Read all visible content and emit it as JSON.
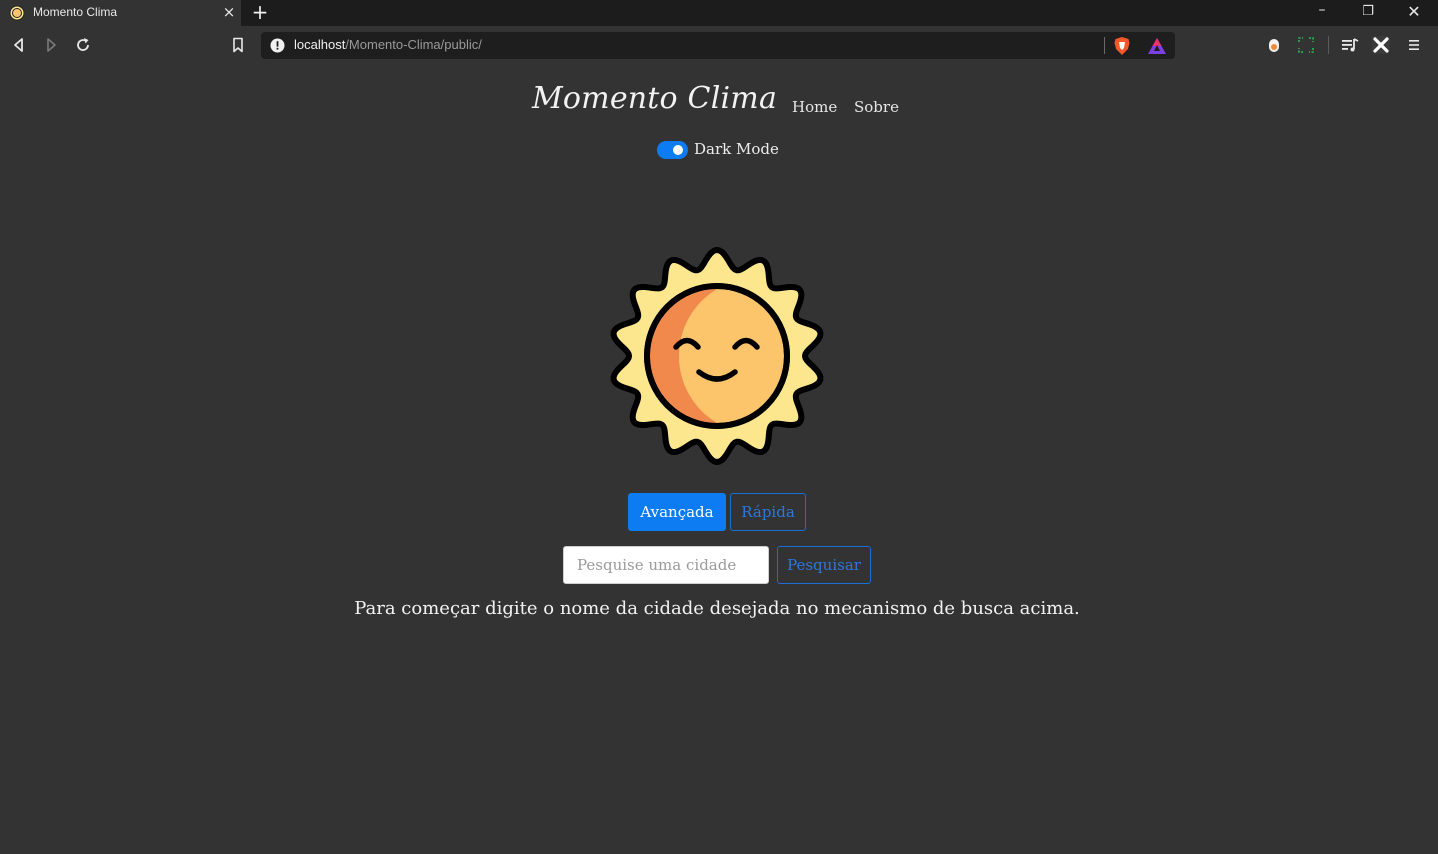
{
  "browser": {
    "tab_title": "Momento Clima",
    "tab_close": "×",
    "new_tab": "+",
    "window_controls": {
      "minimize": "–",
      "restore": "❐",
      "close": "✕"
    },
    "url_host": "localhost",
    "url_path": "/Momento-Clima/public/",
    "icons": [
      "back-icon",
      "forward-icon",
      "reload-icon",
      "bookmark-icon",
      "site-info-icon",
      "brave-shield-icon",
      "brave-rewards-icon",
      "extension-icon",
      "screen-capture-icon",
      "media-queue-icon",
      "extension-x-icon",
      "menu-icon"
    ]
  },
  "header": {
    "brand": "Momento Clima",
    "nav": [
      {
        "label": "Home"
      },
      {
        "label": "Sobre"
      }
    ],
    "dark_mode_label": "Dark Mode",
    "dark_mode_on": true
  },
  "main": {
    "weather_icon": "sun-icon",
    "mode_buttons": {
      "advanced": "Avançada",
      "quick": "Rápida"
    },
    "search": {
      "placeholder": "Pesquise uma cidade",
      "value": "",
      "button": "Pesquisar"
    },
    "hint": "Para começar digite o nome da cidade desejada no mecanismo de busca acima."
  },
  "colors": {
    "background": "#333333",
    "primary": "#0d7cf2",
    "outline": "#2c78df",
    "sun_body": "#fdc56b",
    "sun_rays": "#fde78e",
    "sun_shadow": "#f1894c"
  }
}
